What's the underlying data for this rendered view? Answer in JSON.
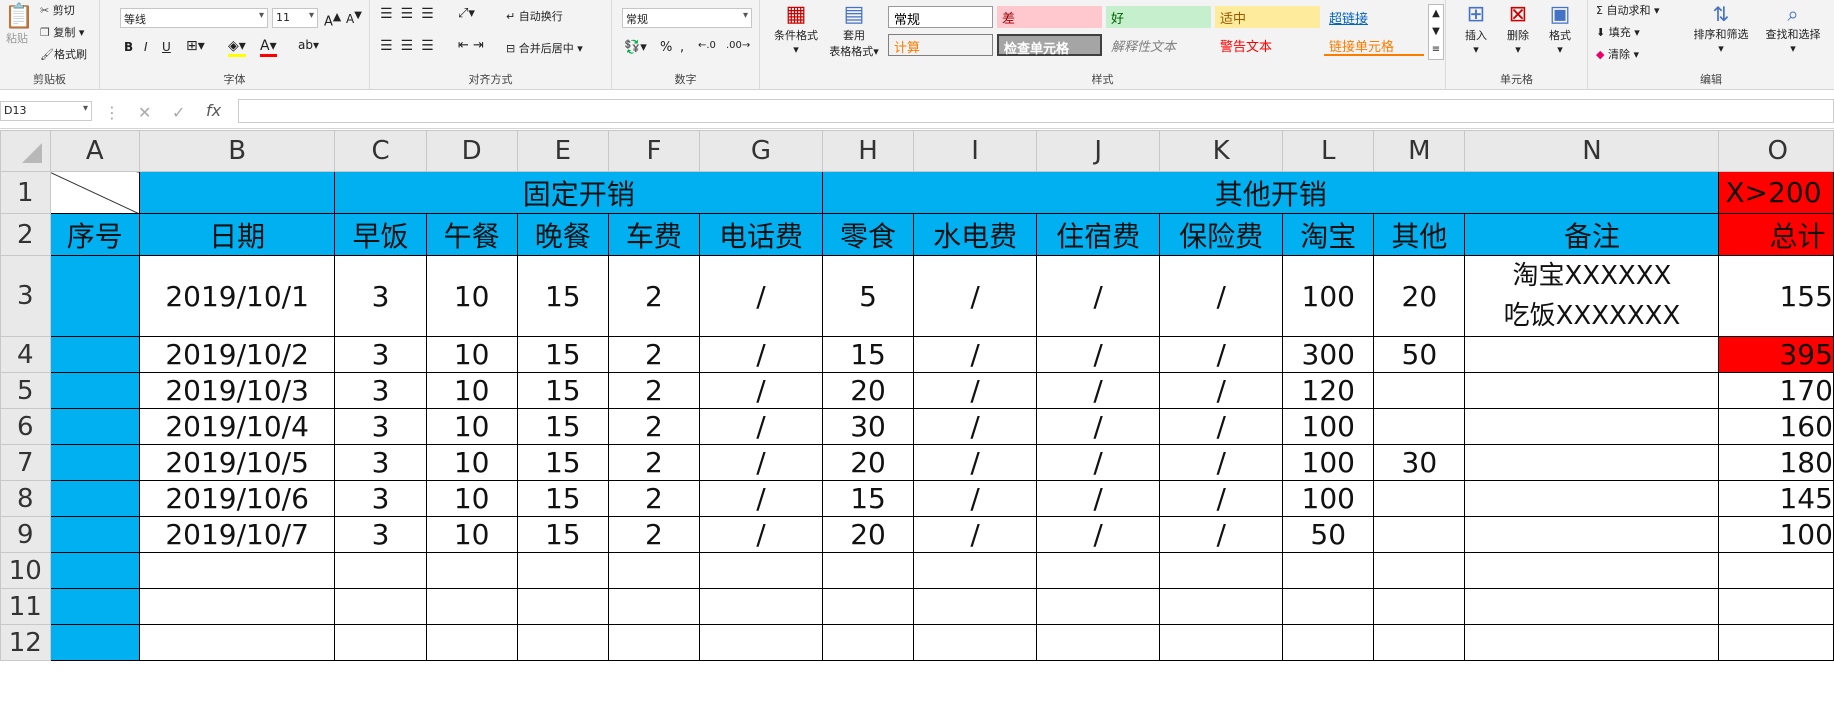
{
  "ribbon": {
    "clipboard": {
      "paste": "粘贴",
      "cut": "剪切",
      "copy": "复制",
      "format_painter": "格式刷",
      "label": "剪贴板"
    },
    "font": {
      "name": "等线",
      "size": "11",
      "label": "字体",
      "bold": "B",
      "italic": "I",
      "underline": "U"
    },
    "alignment": {
      "wrap": "自动换行",
      "merge": "合并后居中",
      "label": "对齐方式"
    },
    "number": {
      "format": "常规",
      "label": "数字",
      "percent": "%",
      "comma": ","
    },
    "styles": {
      "conditional": "条件格式",
      "table_format_1": "套用",
      "table_format_2": "表格格式",
      "items": [
        {
          "text": "常规",
          "bg": "#ffffff",
          "fg": "#000000"
        },
        {
          "text": "差",
          "bg": "#ffc7ce",
          "fg": "#9c0006"
        },
        {
          "text": "好",
          "bg": "#c6efce",
          "fg": "#006100"
        },
        {
          "text": "适中",
          "bg": "#ffeb9c",
          "fg": "#9c5700"
        },
        {
          "text": "超链接",
          "bg": "#f3f3f3",
          "fg": "#0563c1"
        },
        {
          "text": "计算",
          "bg": "#f2f2f2",
          "fg": "#fa7d00"
        },
        {
          "text": "检查单元格",
          "bg": "#a5a5a5",
          "fg": "#ffffff"
        },
        {
          "text": "解释性文本",
          "bg": "#f3f3f3",
          "fg": "#7f7f7f"
        },
        {
          "text": "警告文本",
          "bg": "#f3f3f3",
          "fg": "#ff0000"
        },
        {
          "text": "链接单元格",
          "bg": "#f3f3f3",
          "fg": "#fa7d00"
        }
      ],
      "label": "样式"
    },
    "cells": {
      "insert": "插入",
      "delete": "删除",
      "format": "格式",
      "label": "单元格"
    },
    "editing": {
      "autosum": "自动求和",
      "fill": "填充",
      "clear": "清除",
      "sort": "排序和筛选",
      "find": "查找和选择",
      "label": "编辑"
    }
  },
  "formula_bar": {
    "name_box": "D13",
    "fx": "fx",
    "value": ""
  },
  "sheet": {
    "columns": [
      "A",
      "B",
      "C",
      "D",
      "E",
      "F",
      "G",
      "H",
      "I",
      "J",
      "K",
      "L",
      "M",
      "N",
      "O"
    ],
    "rows": [
      "1",
      "2",
      "3",
      "4",
      "5",
      "6",
      "7",
      "8",
      "9",
      "10",
      "11",
      "12"
    ],
    "header1": {
      "fixed": "固定开销",
      "other": "其他开销",
      "rule": "X>200"
    },
    "header2": [
      "序号",
      "日期",
      "早饭",
      "午餐",
      "晚餐",
      "车费",
      "电话费",
      "零食",
      "水电费",
      "住宿费",
      "保险费",
      "淘宝",
      "其他",
      "备注",
      "总计"
    ],
    "data": [
      {
        "date": "2019/10/1",
        "vals": [
          "3",
          "10",
          "15",
          "2",
          "/",
          "5",
          "/",
          "/",
          "/",
          "100",
          "20"
        ],
        "note": [
          "淘宝XXXXXX",
          "吃饭XXXXXXX"
        ],
        "total": "155"
      },
      {
        "date": "2019/10/2",
        "vals": [
          "3",
          "10",
          "15",
          "2",
          "/",
          "15",
          "/",
          "/",
          "/",
          "300",
          "50"
        ],
        "note": [
          "",
          ""
        ],
        "total": "395"
      },
      {
        "date": "2019/10/3",
        "vals": [
          "3",
          "10",
          "15",
          "2",
          "/",
          "20",
          "/",
          "/",
          "/",
          "120",
          ""
        ],
        "note": [
          "",
          ""
        ],
        "total": "170"
      },
      {
        "date": "2019/10/4",
        "vals": [
          "3",
          "10",
          "15",
          "2",
          "/",
          "30",
          "/",
          "/",
          "/",
          "100",
          ""
        ],
        "note": [
          "",
          ""
        ],
        "total": "160"
      },
      {
        "date": "2019/10/5",
        "vals": [
          "3",
          "10",
          "15",
          "2",
          "/",
          "20",
          "/",
          "/",
          "/",
          "100",
          "30"
        ],
        "note": [
          "",
          ""
        ],
        "total": "180"
      },
      {
        "date": "2019/10/6",
        "vals": [
          "3",
          "10",
          "15",
          "2",
          "/",
          "15",
          "/",
          "/",
          "/",
          "100",
          ""
        ],
        "note": [
          "",
          ""
        ],
        "total": "145"
      },
      {
        "date": "2019/10/7",
        "vals": [
          "3",
          "10",
          "15",
          "2",
          "/",
          "20",
          "/",
          "/",
          "/",
          "50",
          ""
        ],
        "note": [
          "",
          ""
        ],
        "total": "100"
      }
    ]
  }
}
